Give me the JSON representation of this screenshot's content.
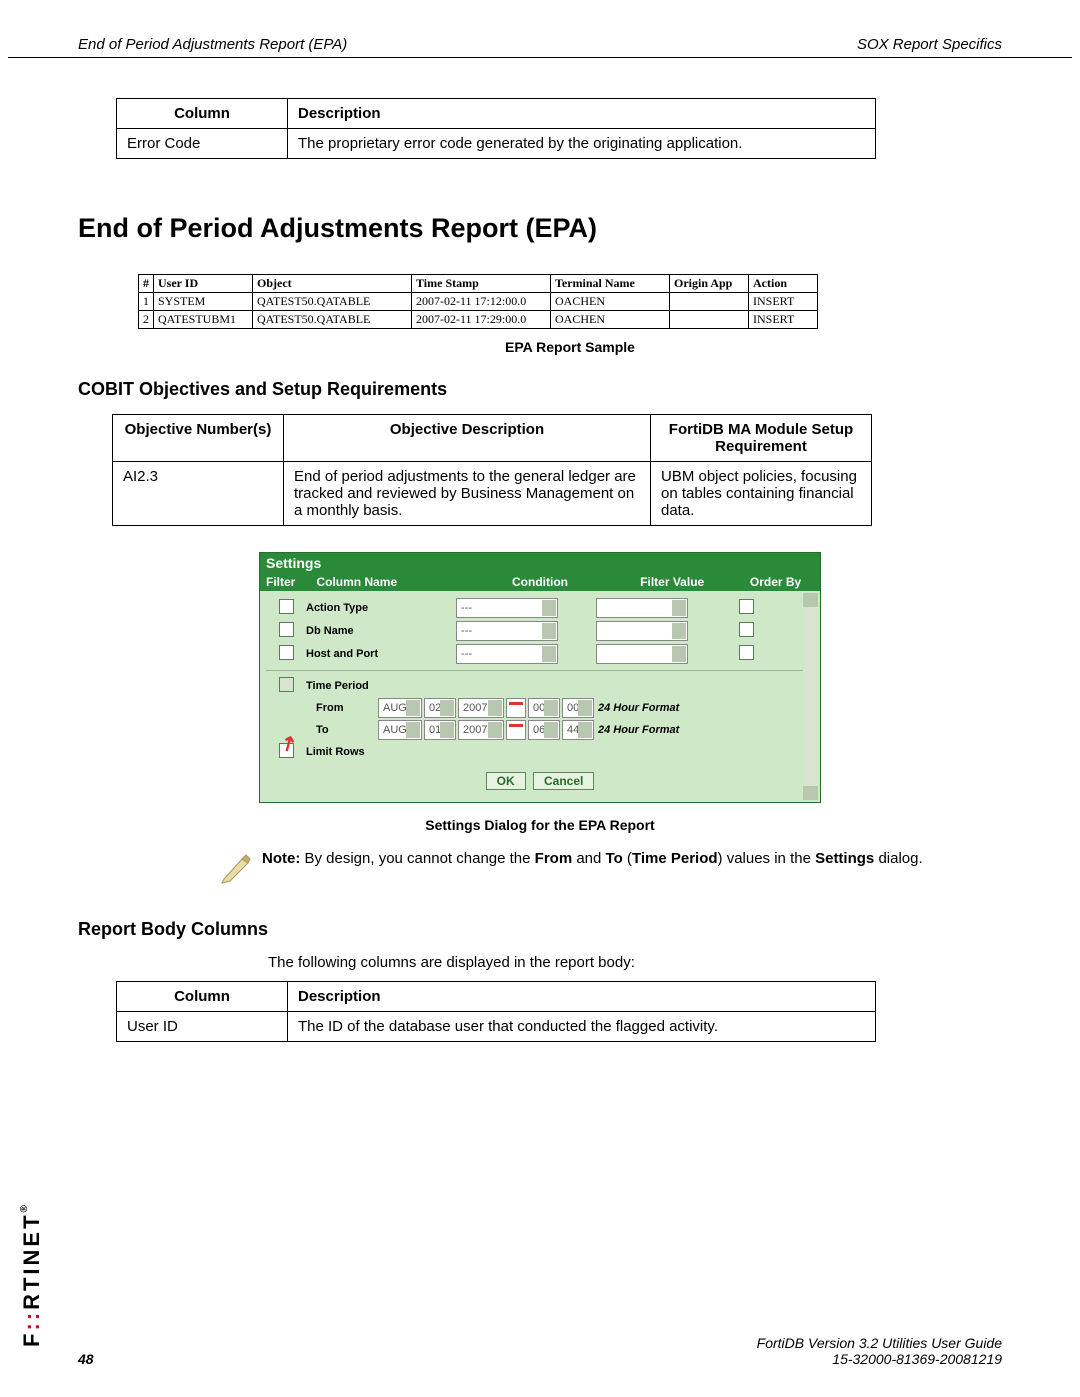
{
  "header": {
    "left": "End of Period Adjustments Report (EPA)",
    "right": "SOX Report Specifics"
  },
  "top_table": {
    "headers": [
      "Column",
      "Description"
    ],
    "row": [
      "Error Code",
      "The proprietary error code generated by the originating application."
    ]
  },
  "title": "End of Period Adjustments Report (EPA)",
  "sample": {
    "headers": [
      "#",
      "User ID",
      "Object",
      "Time Stamp",
      "Terminal Name",
      "Origin App",
      "Action"
    ],
    "rows": [
      [
        "1",
        "SYSTEM",
        "QATEST50.QATABLE",
        "2007-02-11 17:12:00.0",
        "OACHEN",
        "",
        "INSERT"
      ],
      [
        "2",
        "QATESTUBM1",
        "QATEST50.QATABLE",
        "2007-02-11 17:29:00.0",
        "OACHEN",
        "",
        "INSERT"
      ]
    ],
    "caption": "EPA Report Sample"
  },
  "cobit": {
    "heading": "COBIT Objectives and Setup Requirements",
    "headers": [
      "Objective Number(s)",
      "Objective Description",
      "FortiDB MA Module Setup Requirement"
    ],
    "row": [
      "AI2.3",
      "End of period adjustments to the general ledger are tracked and reviewed by Business Management on a monthly basis.",
      "UBM object policies, focusing on tables containing financial data."
    ]
  },
  "settings": {
    "title": "Settings",
    "head": [
      "Filter",
      "Column Name",
      "Condition",
      "Filter Value",
      "Order By"
    ],
    "rows": [
      {
        "label": "Action Type",
        "cond": "---"
      },
      {
        "label": "Db Name",
        "cond": "---"
      },
      {
        "label": "Host and Port",
        "cond": "---"
      }
    ],
    "time_label": "Time Period",
    "from_label": "From",
    "to_label": "To",
    "from": [
      "AUG",
      "02",
      "2007",
      "00",
      "00"
    ],
    "to": [
      "AUG",
      "01",
      "2007",
      "06",
      "44"
    ],
    "hour_fmt": "24 Hour Format",
    "limit_label": "Limit Rows",
    "ok": "OK",
    "cancel": "Cancel",
    "caption": "Settings Dialog for the EPA Report"
  },
  "note": {
    "prefix": "Note:",
    "t1": " By design, you cannot change the ",
    "from": "From",
    "and": " and ",
    "to": "To",
    "par_open": " (",
    "tp": "Time Period",
    "par_close": ")",
    "t2": " values in the ",
    "dlg": "Settings",
    "t3": " dialog."
  },
  "body_columns": {
    "heading": "Report Body Columns",
    "intro": "The following columns are displayed in the report body:",
    "headers": [
      "Column",
      "Description"
    ],
    "row": [
      "User ID",
      "The ID of the database user that conducted the flagged activity."
    ]
  },
  "brand": {
    "fort": "F",
    "accent": "::",
    "rtinet": "RTINET"
  },
  "footer": {
    "page": "48",
    "l1": "FortiDB Version 3.2 Utilities  User Guide",
    "l2": "15-32000-81369-20081219"
  }
}
